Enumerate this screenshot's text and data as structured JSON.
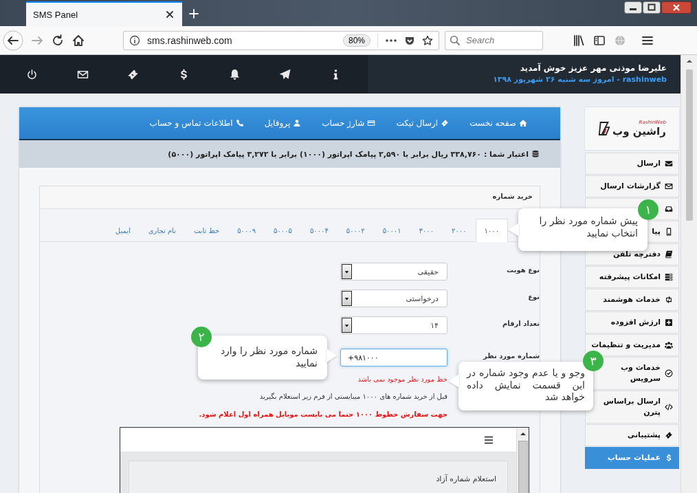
{
  "browser": {
    "tab_title": "SMS Panel",
    "url": "sms.rashinweb.com",
    "zoom": "80%",
    "search_placeholder": "Search"
  },
  "header": {
    "welcome": "علیرضا موذنی مهر عزیز خوش آمدید",
    "subline": "rashinweb - امروز سه شنبه ۲۶ شهریور ۱۳۹۸",
    "icons": [
      {
        "kind": "info"
      },
      {
        "kind": "send"
      },
      {
        "kind": "bell"
      },
      {
        "kind": "dollar"
      },
      {
        "kind": "ticket"
      },
      {
        "kind": "mail"
      },
      {
        "kind": "power"
      }
    ]
  },
  "nav": [
    {
      "label": "صفحه نخست",
      "kind": "home"
    },
    {
      "label": "ارسال تیکت",
      "kind": "ticket"
    },
    {
      "label": "شارژ حساب",
      "kind": "card"
    },
    {
      "label": "پروفایل",
      "kind": "user"
    },
    {
      "label": "اطلاعات تماس و حساب",
      "kind": "phone"
    }
  ],
  "credit": "اعتبار شما : ۳۳۸,۷۶۰ ریال برابر با ۲,۵۹۰ پیامک اپراتور (۱۰۰۰) برابر با ۳,۲۷۲ پیامک اپراتور (۵۰۰۰)",
  "card": {
    "title": "خرید شماره",
    "tabs": [
      {
        "label": "۱۰۰۰",
        "selected": true
      },
      {
        "label": "۲۰۰۰",
        "selected": false
      },
      {
        "label": "۳۰۰۰",
        "selected": false
      },
      {
        "label": "۵۰۰۰۱",
        "selected": false
      },
      {
        "label": "۵۰۰۰۲",
        "selected": false
      },
      {
        "label": "۵۰۰۰۴",
        "selected": false
      },
      {
        "label": "۵۰۰۰۵",
        "selected": false
      },
      {
        "label": "۵۰۰۰۹",
        "selected": false
      },
      {
        "label": "خط ثابت",
        "selected": false
      },
      {
        "label": "نام تجاری",
        "selected": false
      },
      {
        "label": "ایمیل",
        "selected": false
      }
    ],
    "fields": [
      {
        "kind": "select",
        "label": "نوع هویت",
        "value": "حقیقی"
      },
      {
        "kind": "select",
        "label": "نوع",
        "value": "درخواستی"
      },
      {
        "kind": "select",
        "label": "تعداد ارقام",
        "value": "۱۴"
      },
      {
        "kind": "input",
        "label": "شماره مورد نظر",
        "value": "+۹۸۱۰۰۰"
      }
    ],
    "error": "خط مورد نظر موجود نمی باشد",
    "note": "قبل از خرید شماره های ۱۰۰۰ میبایستی از فرم زیر استعلام بگیرید",
    "warning": "جهت سفارش خطوط ۱۰۰۰ حتما می بایست موبایل همراه اول اعلام شود.",
    "frame": {
      "title": "استعلام شماره آزاد"
    }
  },
  "sidebar": {
    "logo": {
      "latin": "RashinWeb",
      "persian": "راشین وب"
    },
    "items": [
      {
        "label": "ارسال",
        "kind": "envelope",
        "selected": false
      },
      {
        "label": "گزارشات ارسال",
        "kind": "envelope-outline",
        "selected": false
      },
      {
        "kind": "inbox",
        "selected": false
      },
      {
        "label": "پیا",
        "kind": "mobile",
        "selected": false
      },
      {
        "label": "دفترچه تلفن",
        "kind": "book",
        "selected": false
      },
      {
        "label": "امکانات پیشرفته",
        "kind": "list",
        "selected": false
      },
      {
        "label": "خدمات هوشمند",
        "kind": "retweet",
        "selected": false
      },
      {
        "label": "ارزش افزوده",
        "kind": "plus-square",
        "selected": false
      },
      {
        "label": "مدیریت و تنظیمات",
        "kind": "users",
        "selected": false
      },
      {
        "label": "خدمات وب سرویس",
        "kind": "check-circle",
        "selected": false
      },
      {
        "label": "ارسال براساس پترن",
        "kind": "code",
        "selected": false
      },
      {
        "label": "پشتیبانی",
        "kind": "ticket",
        "selected": false
      },
      {
        "label": "عملیات حساب",
        "kind": "dollar",
        "selected": true
      }
    ]
  },
  "callouts": [
    {
      "number": "۱",
      "text": "پیش شماره مورد نظر را انتخاب نمایید"
    },
    {
      "number": "۲",
      "text": "شماره مورد نظر را وارد نمایید"
    },
    {
      "number": "۳",
      "text": "وجو و یا عدم وجود شماره در این قسمت نمایش داده خواهد شد"
    }
  ]
}
